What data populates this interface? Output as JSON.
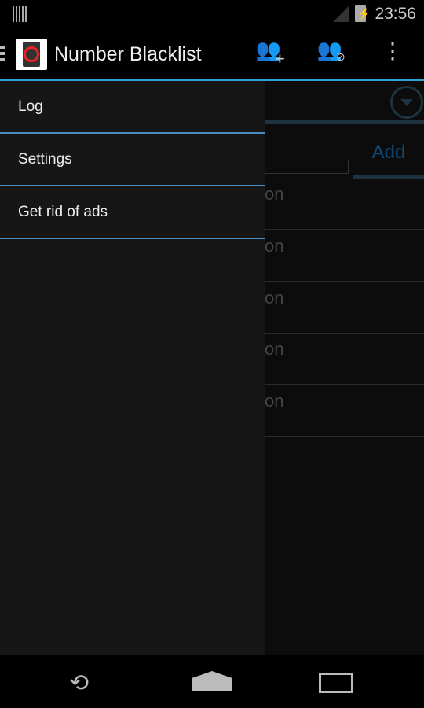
{
  "status": {
    "time": "23:56"
  },
  "actionbar": {
    "title": "Number Blacklist",
    "icons": [
      "add-contact-icon",
      "block-contact-icon",
      "overflow-menu-icon"
    ]
  },
  "content": {
    "add_label": "Add",
    "row_text": "on"
  },
  "drawer": {
    "items": [
      {
        "label": "Log"
      },
      {
        "label": "Settings"
      },
      {
        "label": "Get rid of ads"
      }
    ]
  },
  "colors": {
    "accent": "#33a0d8",
    "drawer_bg": "#161616"
  }
}
